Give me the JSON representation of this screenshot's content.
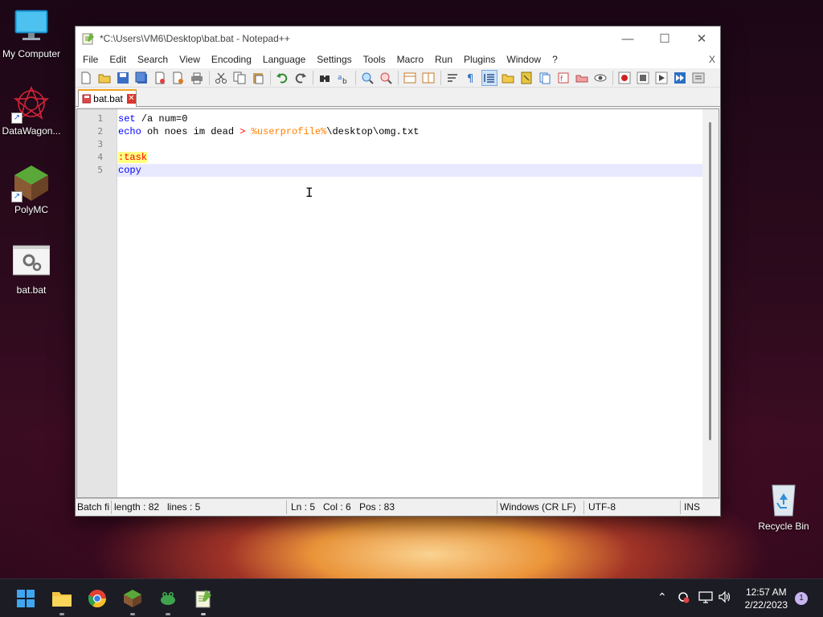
{
  "desktop": {
    "icons": [
      {
        "label": "My Computer",
        "icon": "monitor-icon"
      },
      {
        "label": "DataWagon...",
        "icon": "datawagon-icon"
      },
      {
        "label": "PolyMC",
        "icon": "polymc-icon"
      },
      {
        "label": "bat.bat",
        "icon": "batch-file-icon"
      },
      {
        "label": "Recycle Bin",
        "icon": "recycle-bin-icon"
      }
    ]
  },
  "window": {
    "title": "*C:\\Users\\VM6\\Desktop\\bat.bat - Notepad++",
    "menu": [
      "File",
      "Edit",
      "Search",
      "View",
      "Encoding",
      "Language",
      "Settings",
      "Tools",
      "Macro",
      "Run",
      "Plugins",
      "Window",
      "?"
    ],
    "menu_close": "X",
    "tab": {
      "label": "bat.bat"
    },
    "lines": [
      {
        "num": "1",
        "parts": [
          {
            "t": "set",
            "c": "kw"
          },
          {
            "t": " /a num=0",
            "c": "txt"
          }
        ]
      },
      {
        "num": "2",
        "parts": [
          {
            "t": "echo",
            "c": "kw"
          },
          {
            "t": " oh noes im dead ",
            "c": "txt"
          },
          {
            "t": ">",
            "c": "op"
          },
          {
            "t": " ",
            "c": "txt"
          },
          {
            "t": "%userprofile%",
            "c": "var"
          },
          {
            "t": "\\desktop\\omg.txt",
            "c": "txt"
          }
        ]
      },
      {
        "num": "3",
        "parts": []
      },
      {
        "num": "4",
        "parts": [
          {
            "t": ":task",
            "c": "lbl"
          }
        ]
      },
      {
        "num": "5",
        "parts": [
          {
            "t": "copy",
            "c": "kw"
          }
        ]
      }
    ],
    "status": {
      "type": "Batch fi",
      "length": "length : 82",
      "lines": "lines : 5",
      "ln": "Ln : 5",
      "col": "Col : 6",
      "pos": "Pos : 83",
      "eol": "Windows (CR LF)",
      "encoding": "UTF-8",
      "mode": "INS"
    }
  },
  "taskbar": {
    "apps": [
      "start-icon",
      "file-explorer-icon",
      "chrome-icon",
      "polymc-icon",
      "frog-app-icon",
      "notepadpp-icon"
    ],
    "clock_time": "12:57 AM",
    "clock_date": "2/22/2023",
    "notification_count": "1"
  },
  "colors": {
    "keyword": "#0000ff",
    "operator": "#ff0000",
    "variable": "#ff8000",
    "label_bg": "#ffff80",
    "current_line": "#e8e8ff",
    "tab_accent": "#f4a21c"
  }
}
